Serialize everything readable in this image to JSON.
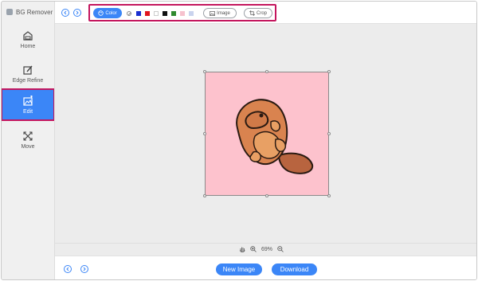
{
  "app": {
    "title": "BG Remover"
  },
  "sidebar": {
    "items": [
      {
        "label": "Home",
        "icon": "home-icon",
        "active": false
      },
      {
        "label": "Edge Refine",
        "icon": "edge-refine-icon",
        "active": false
      },
      {
        "label": "Edit",
        "icon": "edit-image-icon",
        "active": true
      },
      {
        "label": "Move",
        "icon": "move-icon",
        "active": false
      }
    ]
  },
  "toolbar": {
    "undo_icon": "undo-icon",
    "redo_icon": "redo-icon",
    "color_label": "Color",
    "swatches": [
      "none",
      "#1a2fd0",
      "#e0141e",
      "#ffffff",
      "#111111",
      "#2f8a2f",
      "#f6c2ce",
      "#c9d3ee"
    ],
    "image_label": "Image",
    "crop_label": "Crop"
  },
  "canvas": {
    "background_color": "#fdc2cd",
    "subject": "platypus-illustration"
  },
  "zoom": {
    "level": "69%"
  },
  "bottom": {
    "new_image_label": "New Image",
    "download_label": "Download"
  },
  "colors": {
    "accent": "#3b86f7",
    "highlight": "#c4165e"
  }
}
